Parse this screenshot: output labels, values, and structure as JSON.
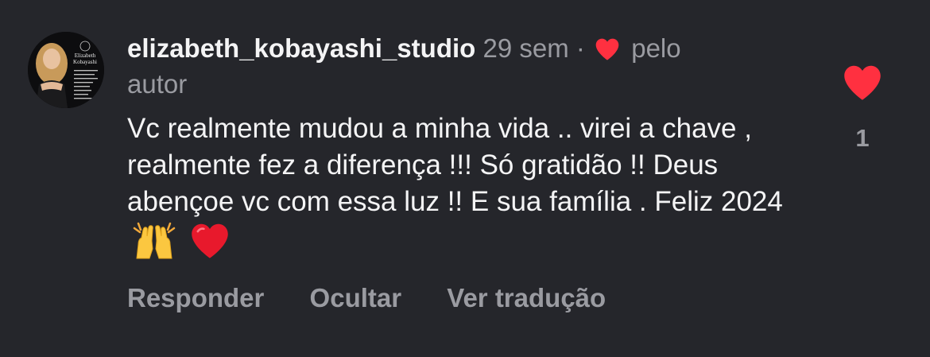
{
  "comment": {
    "avatar_icon": "profile-avatar",
    "avatar_logo_text": "Elizabeth Kobayashi",
    "username": "elizabeth_kobayashi_studio",
    "time": "29 sem",
    "separator": "·",
    "liked_by_author_icon": "heart-icon",
    "liked_by_author_prefix": "pelo",
    "liked_by_author_suffix": "autor",
    "text": "Vc realmente mudou a minha vida .. virei a chave , realmente fez a diferença !!! Só gratidão !! Deus abençoe vc com essa luz !! E sua família . Feliz 2024",
    "emojis": [
      "raising-hands-emoji",
      "red-heart-emoji"
    ],
    "actions": {
      "reply": "Responder",
      "hide": "Ocultar",
      "translate": "Ver tradução"
    },
    "like_count": "1",
    "like_icon": "heart-icon",
    "colors": {
      "background": "#25262b",
      "text": "#f4f4f5",
      "muted": "#9a9ba1",
      "heart": "#ff3040"
    }
  }
}
